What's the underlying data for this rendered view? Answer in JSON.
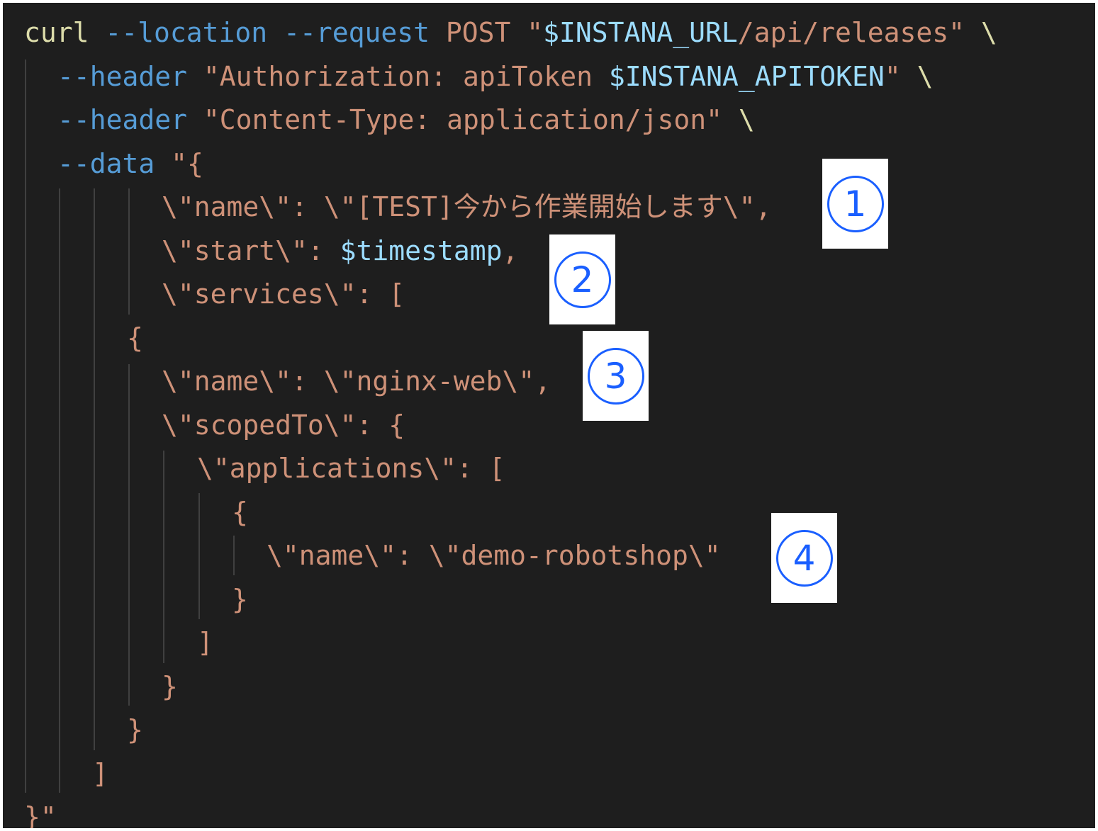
{
  "code_lines": [
    {
      "tokens": [
        {
          "cls": "tok-cmd",
          "text": "curl"
        },
        {
          "cls": "tok-plain",
          "text": " "
        },
        {
          "cls": "tok-flag",
          "text": "--location"
        },
        {
          "cls": "tok-plain",
          "text": " "
        },
        {
          "cls": "tok-flag",
          "text": "--request"
        },
        {
          "cls": "tok-plain",
          "text": " "
        },
        {
          "cls": "tok-str",
          "text": "POST"
        },
        {
          "cls": "tok-plain",
          "text": " "
        },
        {
          "cls": "tok-str",
          "text": "\""
        },
        {
          "cls": "tok-var",
          "text": "$INSTANA_URL"
        },
        {
          "cls": "tok-str",
          "text": "/api/releases\""
        },
        {
          "cls": "tok-plain",
          "text": " "
        },
        {
          "cls": "tok-cmd",
          "text": "\\"
        }
      ]
    },
    {
      "tokens": [
        {
          "cls": "tok-flag",
          "text": "--header"
        },
        {
          "cls": "tok-plain",
          "text": " "
        },
        {
          "cls": "tok-str",
          "text": "\"Authorization: apiToken "
        },
        {
          "cls": "tok-var",
          "text": "$INSTANA_APITOKEN"
        },
        {
          "cls": "tok-str",
          "text": "\""
        },
        {
          "cls": "tok-plain",
          "text": " "
        },
        {
          "cls": "tok-cmd",
          "text": "\\"
        }
      ]
    },
    {
      "tokens": [
        {
          "cls": "tok-flag",
          "text": "--header"
        },
        {
          "cls": "tok-plain",
          "text": " "
        },
        {
          "cls": "tok-str",
          "text": "\"Content-Type: application/json\""
        },
        {
          "cls": "tok-plain",
          "text": " "
        },
        {
          "cls": "tok-cmd",
          "text": "\\"
        }
      ]
    },
    {
      "tokens": [
        {
          "cls": "tok-flag",
          "text": "--data"
        },
        {
          "cls": "tok-plain",
          "text": " "
        },
        {
          "cls": "tok-str",
          "text": "\"{"
        }
      ]
    },
    {
      "tokens": [
        {
          "cls": "tok-str",
          "text": "\\\"name\\\": \\\"[TEST]今から作業開始します\\\","
        }
      ]
    },
    {
      "tokens": [
        {
          "cls": "tok-str",
          "text": "\\\"start\\\": "
        },
        {
          "cls": "tok-var",
          "text": "$timestamp"
        },
        {
          "cls": "tok-str",
          "text": ","
        }
      ]
    },
    {
      "tokens": [
        {
          "cls": "tok-str",
          "text": "\\\"services\\\": ["
        }
      ]
    },
    {
      "tokens": [
        {
          "cls": "tok-str",
          "text": "{"
        }
      ]
    },
    {
      "tokens": [
        {
          "cls": "tok-str",
          "text": "\\\"name\\\": \\\"nginx-web\\\","
        }
      ]
    },
    {
      "tokens": [
        {
          "cls": "tok-str",
          "text": "\\\"scopedTo\\\": {"
        }
      ]
    },
    {
      "tokens": [
        {
          "cls": "tok-str",
          "text": "\\\"applications\\\": ["
        }
      ]
    },
    {
      "tokens": [
        {
          "cls": "tok-str",
          "text": "{"
        }
      ]
    },
    {
      "tokens": [
        {
          "cls": "tok-str",
          "text": "\\\"name\\\": \\\"demo-robotshop\\\""
        }
      ]
    },
    {
      "tokens": [
        {
          "cls": "tok-str",
          "text": "}"
        }
      ]
    },
    {
      "tokens": [
        {
          "cls": "tok-str",
          "text": "]"
        }
      ]
    },
    {
      "tokens": [
        {
          "cls": "tok-str",
          "text": "}"
        }
      ]
    },
    {
      "tokens": [
        {
          "cls": "tok-str",
          "text": "}"
        }
      ]
    },
    {
      "tokens": [
        {
          "cls": "tok-str",
          "text": "]"
        }
      ]
    },
    {
      "tokens": [
        {
          "cls": "tok-str",
          "text": "}\""
        }
      ]
    }
  ],
  "callouts": [
    {
      "label": "1"
    },
    {
      "label": "2"
    },
    {
      "label": "3"
    },
    {
      "label": "4"
    }
  ],
  "colors": {
    "background": "#1e1e1e",
    "command": "#dcdcaa",
    "flag": "#569cd6",
    "string": "#ce9178",
    "variable": "#9cdcfe",
    "callout": "#1a5fff"
  }
}
